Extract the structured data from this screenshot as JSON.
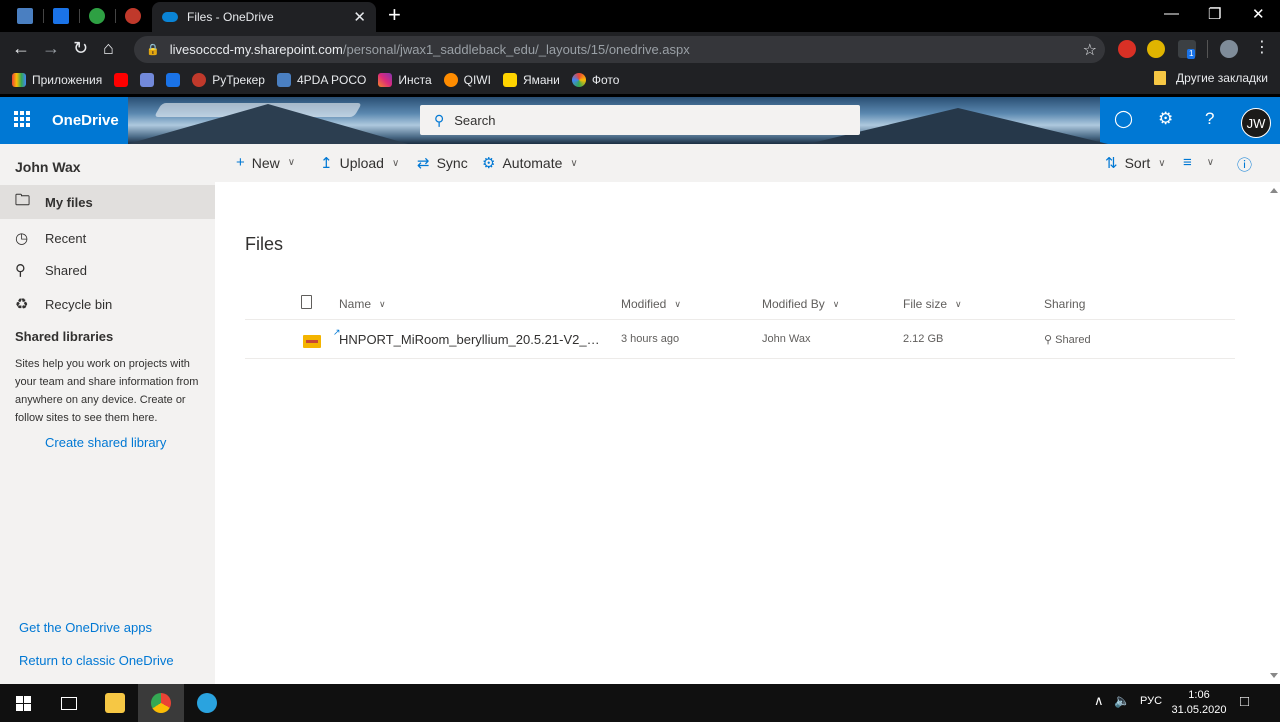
{
  "browser": {
    "active_tab_title": "Files - OneDrive",
    "tab_close": "✕",
    "new_tab": "+",
    "url_host": "livesocccd-my.sharepoint.com",
    "url_path": "/personal/jwax1_saddleback_edu/_layouts/15/onedrive.aspx",
    "bookmarks": [
      "Приложения",
      "РуТрекер",
      "4PDA POCO",
      "Инста",
      "QIWI",
      "Ямани",
      "Фото"
    ],
    "other_bookmarks": "Другие закладки",
    "extension_badge": "1"
  },
  "suite": {
    "app_name": "OneDrive",
    "search_placeholder": "Search",
    "avatar_initials": "JW"
  },
  "nav": {
    "user_name": "John Wax",
    "items": [
      {
        "label": "My files"
      },
      {
        "label": "Recent"
      },
      {
        "label": "Shared"
      },
      {
        "label": "Recycle bin"
      }
    ],
    "shared_libraries_heading": "Shared libraries",
    "shared_libraries_desc": "Sites help you work on projects with your team and share information from anywhere on any device. Create or follow sites to see them here.",
    "create_shared_library": "Create shared library",
    "get_apps": "Get the OneDrive apps",
    "return_classic": "Return to classic OneDrive"
  },
  "commands": {
    "new": "New",
    "upload": "Upload",
    "sync": "Sync",
    "automate": "Automate",
    "sort": "Sort"
  },
  "files": {
    "title": "Files",
    "columns": {
      "name": "Name",
      "modified": "Modified",
      "modified_by": "Modified By",
      "file_size": "File size",
      "sharing": "Sharing"
    },
    "rows": [
      {
        "name": "HNPORT_MiRoom_beryllium_20.5.21-V2_10...",
        "modified": "3 hours ago",
        "modified_by": "John Wax",
        "size": "2.12 GB",
        "sharing": "Shared"
      }
    ]
  },
  "taskbar": {
    "language": "РУС",
    "time": "1:06",
    "date": "31.05.2020"
  },
  "colors": {
    "accent": "#0078d4",
    "nav_bg": "#f3f2f1",
    "browser_bg": "#202124"
  }
}
